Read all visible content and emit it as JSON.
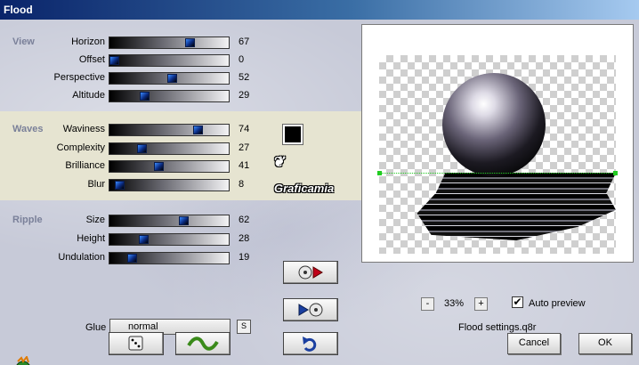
{
  "window": {
    "title": "Flood"
  },
  "groups": {
    "view": "View",
    "waves": "Waves",
    "ripple": "Ripple"
  },
  "sliders": {
    "view": [
      {
        "label": "Horizon",
        "value": 67,
        "fraction": 0.67
      },
      {
        "label": "Offset",
        "value": 0,
        "fraction": 0.0
      },
      {
        "label": "Perspective",
        "value": 52,
        "fraction": 0.52
      },
      {
        "label": "Altitude",
        "value": 29,
        "fraction": 0.29
      }
    ],
    "waves": [
      {
        "label": "Waviness",
        "value": 74,
        "fraction": 0.74
      },
      {
        "label": "Complexity",
        "value": 27,
        "fraction": 0.27
      },
      {
        "label": "Brilliance",
        "value": 41,
        "fraction": 0.41
      },
      {
        "label": "Blur",
        "value": 8,
        "fraction": 0.08
      }
    ],
    "ripple": [
      {
        "label": "Size",
        "value": 62,
        "fraction": 0.62
      },
      {
        "label": "Height",
        "value": 28,
        "fraction": 0.28
      },
      {
        "label": "Undulation",
        "value": 19,
        "fraction": 0.19
      }
    ]
  },
  "glue": {
    "label": "Glue",
    "value": "normal",
    "button": "S"
  },
  "preview": {
    "zoom": "33%",
    "zoom_minus": "-",
    "zoom_plus": "+",
    "auto_preview_label": "Auto preview",
    "auto_preview_checked": true,
    "settings_file": "Flood settings.q8r"
  },
  "watermark": "Graficamia",
  "buttons": {
    "cancel": "Cancel",
    "ok": "OK"
  },
  "colors": {
    "wave_color": "#000000",
    "horizon_line": "#22cc22"
  }
}
